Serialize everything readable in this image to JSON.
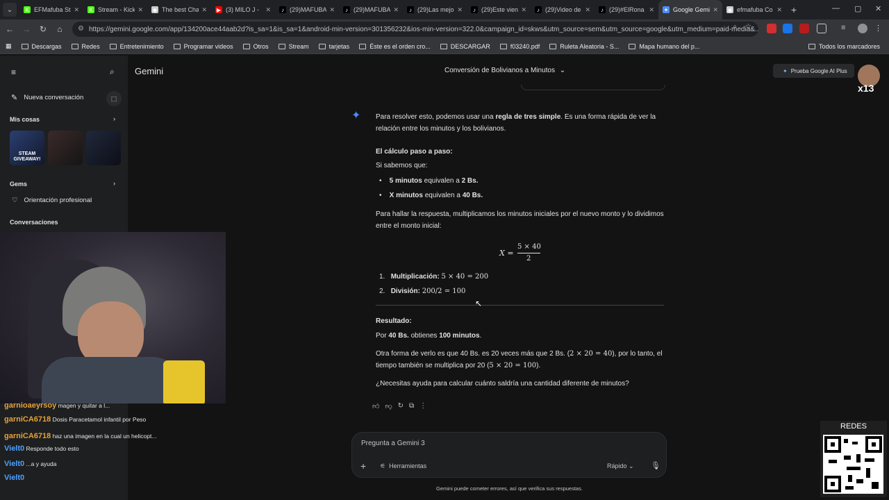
{
  "browser": {
    "tabs": [
      {
        "label": "EFMafuba Stu",
        "fav_color": "#53fc18",
        "fav": "K"
      },
      {
        "label": "Stream - Kick",
        "fav_color": "#53fc18",
        "fav": "K"
      },
      {
        "label": "The best Chat",
        "fav_color": "#cccccc",
        "fav": "◆"
      },
      {
        "label": "(3) MILO J -",
        "fav_color": "#ff0000",
        "fav": "▶"
      },
      {
        "label": "(29)MAFUBA",
        "fav_color": "#000000",
        "fav": "♪"
      },
      {
        "label": "(29)MAFUBA",
        "fav_color": "#000000",
        "fav": "♪"
      },
      {
        "label": "(29)Las mejo",
        "fav_color": "#000000",
        "fav": "♪"
      },
      {
        "label": "(29)Este vien",
        "fav_color": "#000000",
        "fav": "♪"
      },
      {
        "label": "(29)Video de",
        "fav_color": "#000000",
        "fav": "♪"
      },
      {
        "label": "(29)#ElRona",
        "fav_color": "#000000",
        "fav": "♪"
      },
      {
        "label": "Google Gemi",
        "fav_color": "#4c8df6",
        "fav": "✦",
        "active": true
      },
      {
        "label": "efmafuba Co",
        "fav_color": "#cccccc",
        "fav": "◉"
      }
    ],
    "url": "https://gemini.google.com/app/134200ace44aab2d?is_sa=1&is_sa=1&android-min-version=301356232&ios-min-version=322.0&campaign_id=skws&utm_source=sem&utm_source=google&utm_medium=paid-media&...",
    "bookmarks": [
      "Descargas",
      "Redes",
      "Entretenimiento",
      "Programar videos",
      "Otros",
      "Stream",
      "tarjetas",
      "Éste es el orden cro...",
      "DESCARGAR",
      "f03240.pdf",
      "Ruleta Aleatoria - S...",
      "Mapa humano del p..."
    ],
    "bookmarks_right": "Todos los marcadores"
  },
  "sidebar": {
    "new_chat": "Nueva conversación",
    "my_stuff": "Mis cosas",
    "gems": "Gems",
    "gem_item": "Orientación profesional",
    "conversations": "Conversaciones",
    "thumb1_text": "STEAM GIVEAWAY!"
  },
  "header": {
    "app_name": "Gemini",
    "conversation_title": "Conversión de Bolivianos a Minutos",
    "upgrade_button": "Prueba Google AI Plus",
    "avatar_badge": "x13"
  },
  "answer": {
    "intro_a": "Para resolver esto, podemos usar una ",
    "intro_b": "regla de tres simple",
    "intro_c": ". Es una forma rápida de ver la",
    "intro_d": "relación entre los minutos y los bolivianos.",
    "step_heading": "El cálculo paso a paso:",
    "if_we_know": "Si sabemos que:",
    "bullet1_b": "5 minutos",
    "bullet1_t": " equivalen a ",
    "bullet1_v": "2 Bs.",
    "bullet2_b": "X minutos",
    "bullet2_t": " equivalen a ",
    "bullet2_v": "40 Bs.",
    "para_a": "Para hallar la respuesta, multiplicamos los minutos iniciales por el nuevo monto y lo dividimos",
    "para_b": "entre el monto inicial:",
    "formula_lhs": "X =",
    "formula_num": "5 × 40",
    "formula_den": "2",
    "step1_num": "1.",
    "step1_label": "Multiplicación:",
    "step1_math": "5 × 40 = 200",
    "step2_num": "2.",
    "step2_label": "División:",
    "step2_math": "200/2 = 100",
    "result_heading": "Resultado:",
    "result_a": "Por ",
    "result_b": "40 Bs.",
    "result_c": " obtienes ",
    "result_d": "100 minutos",
    "result_e": ".",
    "other_a": "Otra forma de verlo es que 40 Bs. es 20 veces más que 2 Bs. (",
    "other_math1": "2 × 20 = 40",
    "other_b": "), por lo tanto, el",
    "other_c": "tiempo también se multiplica por 20 (",
    "other_math2": "5 × 20 = 100",
    "other_d": ").",
    "question": "¿Necesitas ayuda para calcular cuánto saldría una cantidad diferente de minutos?"
  },
  "input": {
    "placeholder": "Pregunta a Gemini 3",
    "tools": "Herramientas",
    "mode": "Rápido"
  },
  "disclaimer": "Gemini puede cometer errores, así que verifica sus respuestas.",
  "overlay": {
    "redes": "REDES",
    "chat": [
      {
        "user": "garnioaeyrsoy",
        "msg": "magen y quitar a l...",
        "color": "#e6a23c"
      },
      {
        "user": "garniCA6718",
        "msg": "Dosis Paracetamol infantil por Peso",
        "color": "#e6a23c"
      },
      {
        "user": "garniCA6718",
        "msg": "haz una imagen en la cual un helicopt...",
        "color": "#e6a23c"
      },
      {
        "user": "Vielt0",
        "msg": "Responde todo esto",
        "color": "#4ea0ff"
      },
      {
        "user": "Vielt0",
        "msg": "...a y ayuda",
        "color": "#4ea0ff"
      },
      {
        "user": "Vielt0",
        "msg": "",
        "color": "#4ea0ff"
      }
    ]
  }
}
